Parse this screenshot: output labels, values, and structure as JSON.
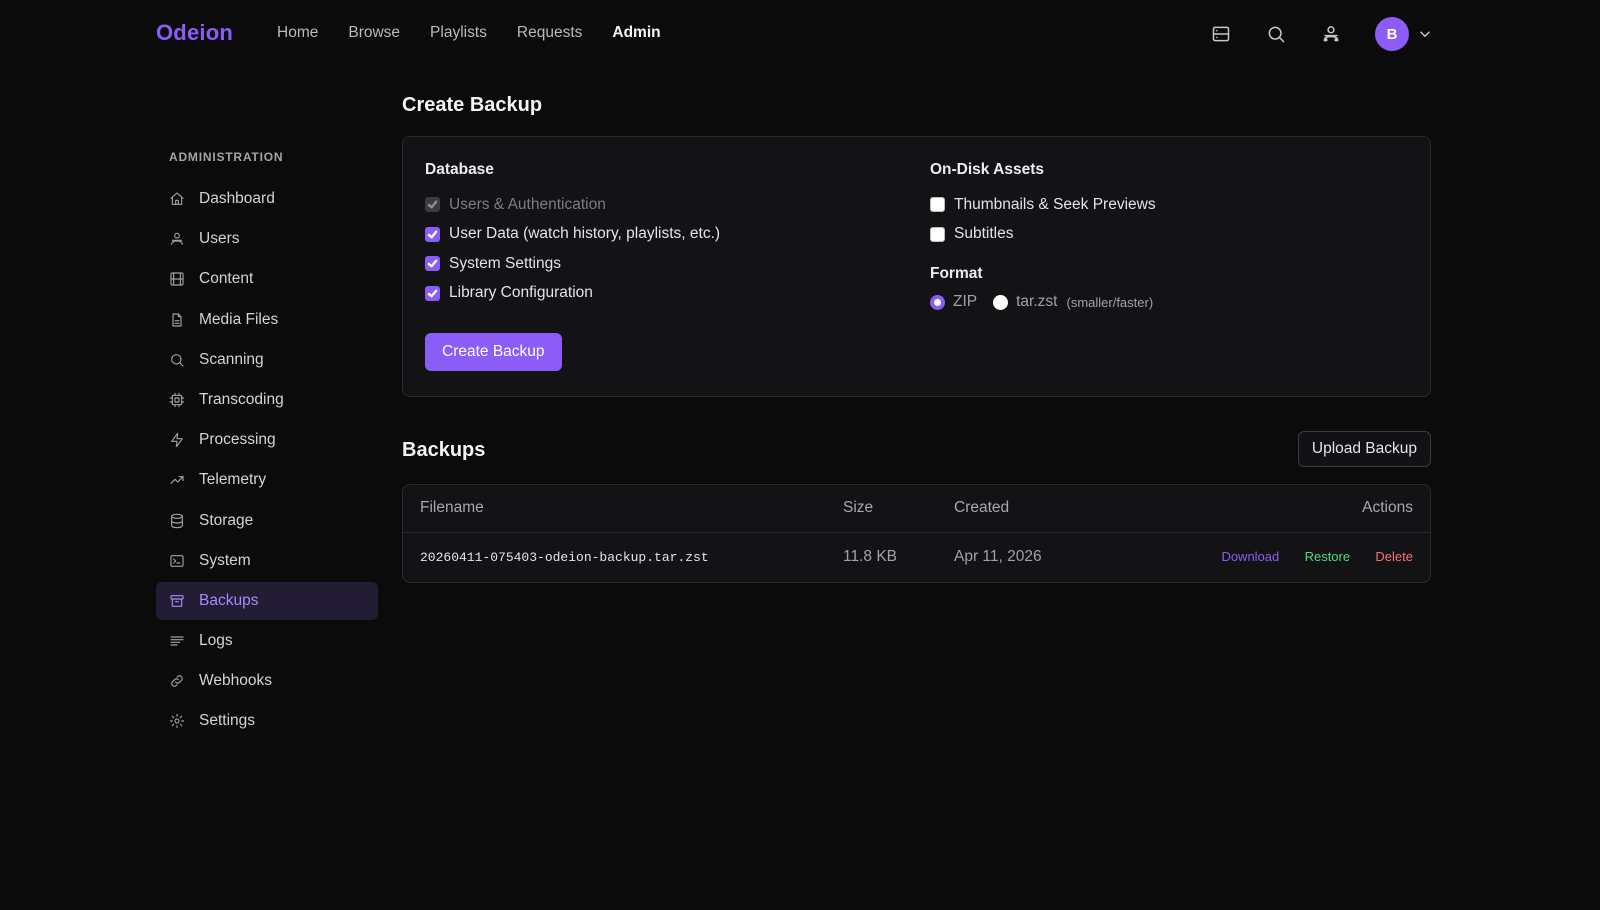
{
  "app": {
    "brand": "Odeion",
    "nav": [
      {
        "label": "Home",
        "active": false
      },
      {
        "label": "Browse",
        "active": false
      },
      {
        "label": "Playlists",
        "active": false
      },
      {
        "label": "Requests",
        "active": false
      },
      {
        "label": "Admin",
        "active": true
      }
    ],
    "top_icons": [
      "server-icon",
      "search-icon",
      "users-icon"
    ],
    "avatar_initial": "B",
    "accent": "#8b5cf6"
  },
  "sidebar": {
    "heading": "ADMINISTRATION",
    "items": [
      {
        "label": "Dashboard",
        "icon": "home-icon"
      },
      {
        "label": "Users",
        "icon": "users-icon"
      },
      {
        "label": "Content",
        "icon": "film-icon"
      },
      {
        "label": "Media Files",
        "icon": "file-icon"
      },
      {
        "label": "Scanning",
        "icon": "search-icon"
      },
      {
        "label": "Transcoding",
        "icon": "cpu-icon"
      },
      {
        "label": "Processing",
        "icon": "zap-icon"
      },
      {
        "label": "Telemetry",
        "icon": "trending-icon"
      },
      {
        "label": "Storage",
        "icon": "database-icon"
      },
      {
        "label": "System",
        "icon": "terminal-icon"
      },
      {
        "label": "Backups",
        "icon": "archive-icon",
        "active": true
      },
      {
        "label": "Logs",
        "icon": "lines-icon"
      },
      {
        "label": "Webhooks",
        "icon": "link-icon"
      },
      {
        "label": "Settings",
        "icon": "gear-icon"
      }
    ]
  },
  "create": {
    "title": "Create Backup",
    "database_label": "Database",
    "database_options": [
      {
        "label": "Users & Authentication",
        "checked": true,
        "disabled": true
      },
      {
        "label": "User Data (watch history, playlists, etc.)",
        "checked": true,
        "disabled": false
      },
      {
        "label": "System Settings",
        "checked": true,
        "disabled": false
      },
      {
        "label": "Library Configuration",
        "checked": true,
        "disabled": false
      }
    ],
    "assets_label": "On-Disk Assets",
    "asset_options": [
      {
        "label": "Thumbnails & Seek Previews",
        "checked": false
      },
      {
        "label": "Subtitles",
        "checked": false
      }
    ],
    "format_label": "Format",
    "format_options": [
      {
        "label": "ZIP",
        "selected": true
      },
      {
        "label": "tar.zst",
        "selected": false,
        "hint": "(smaller/faster)"
      }
    ],
    "button": "Create Backup"
  },
  "backups": {
    "title": "Backups",
    "upload_button": "Upload Backup",
    "columns": {
      "filename": "Filename",
      "size": "Size",
      "created": "Created",
      "actions": "Actions"
    },
    "rows": [
      {
        "filename": "20260411-075403-odeion-backup.tar.zst",
        "size": "11.8 KB",
        "created": "Apr 11, 2026",
        "actions": {
          "download": "Download",
          "restore": "Restore",
          "delete": "Delete"
        }
      }
    ]
  }
}
